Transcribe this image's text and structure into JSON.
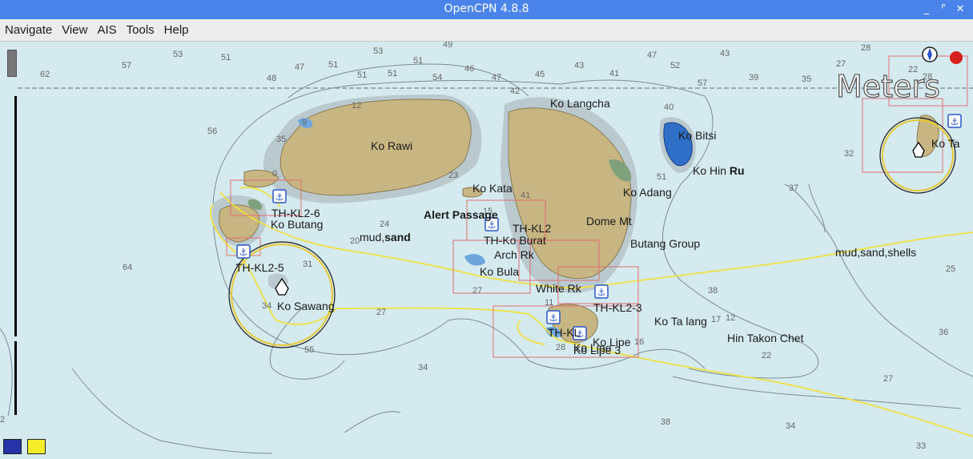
{
  "window": {
    "title": "OpenCPN 4.8.8",
    "minimize": "_",
    "maximize": "ᴾ",
    "close": "✕"
  },
  "menu": {
    "items": [
      "Navigate",
      "View",
      "AIS",
      "Tools",
      "Help"
    ]
  },
  "chart": {
    "scale_label": "Meters",
    "scale_left": "2",
    "labels": {
      "ko_rawi": "Ko Rawi",
      "ko_langcha": "Ko Langcha",
      "ko_bitsi": "Ko Bitsi",
      "ko_hin_ru_a": "Ko Hin ",
      "ko_hin_ru_b": "Ru",
      "ko_adang": "Ko Adang",
      "ko_kata": "Ko Kata",
      "alert_passage": "Alert Passage",
      "dome_mt": "Dome Mt",
      "ko_butang": "Ko Butang",
      "th_kl2_6": "TH-KL2-6",
      "mud_sand_a": "mud,",
      "mud_sand_b": "sand",
      "th_ko_burat": "TH-Ko Burat",
      "th_kl2": "TH-KL2",
      "arch_rk": "Arch Rk",
      "butang_group": "Butang Group",
      "mud_sand_shells": "mud,sand,shells",
      "th_kl2_5": "TH-KL2-5",
      "ko_bula": "Ko Bula",
      "white_rk": "White Rk",
      "th_kl2_3": "TH-KL2-3",
      "ko_sawang": "Ko Sawang",
      "ko_ta_lang": "Ko Ta lang",
      "hin_takon_chet": "Hin Takon Chet",
      "th_kl_partial": "TH-KL",
      "ko_lipe_1": "Ko Lipe",
      "ko_lipe_2": "Ko Lipe",
      "ko_lipe_3": "Ko Lipe 3",
      "ko_ta_right": "Ko Ta"
    },
    "depths": [
      "53",
      "51",
      "57",
      "62",
      "47",
      "51",
      "48",
      "51",
      "51",
      "53",
      "49",
      "51",
      "54",
      "46",
      "47",
      "45",
      "42",
      "43",
      "41",
      "47",
      "52",
      "57",
      "43",
      "39",
      "35",
      "27",
      "28",
      "22",
      "28",
      "56",
      "35",
      "12",
      "9",
      "40",
      "23",
      "41",
      "51",
      "37",
      "32",
      "24",
      "20",
      "15",
      "64",
      "31",
      "34",
      "27",
      "27",
      "11",
      "25",
      "38",
      "17",
      "12",
      "22",
      "36",
      "27",
      "34",
      "38",
      "34",
      "33",
      "55",
      "28",
      "16",
      "0"
    ]
  },
  "colors": {
    "title_bar": "#4a84ea",
    "sea": "#d4eaef",
    "land": "#c7b582",
    "route": "#f0e040",
    "boundary": "#e07070",
    "anchor": "#2a55c8"
  },
  "palette": {
    "chip1": "#2733a8",
    "chip2": "#f4ee2a"
  }
}
